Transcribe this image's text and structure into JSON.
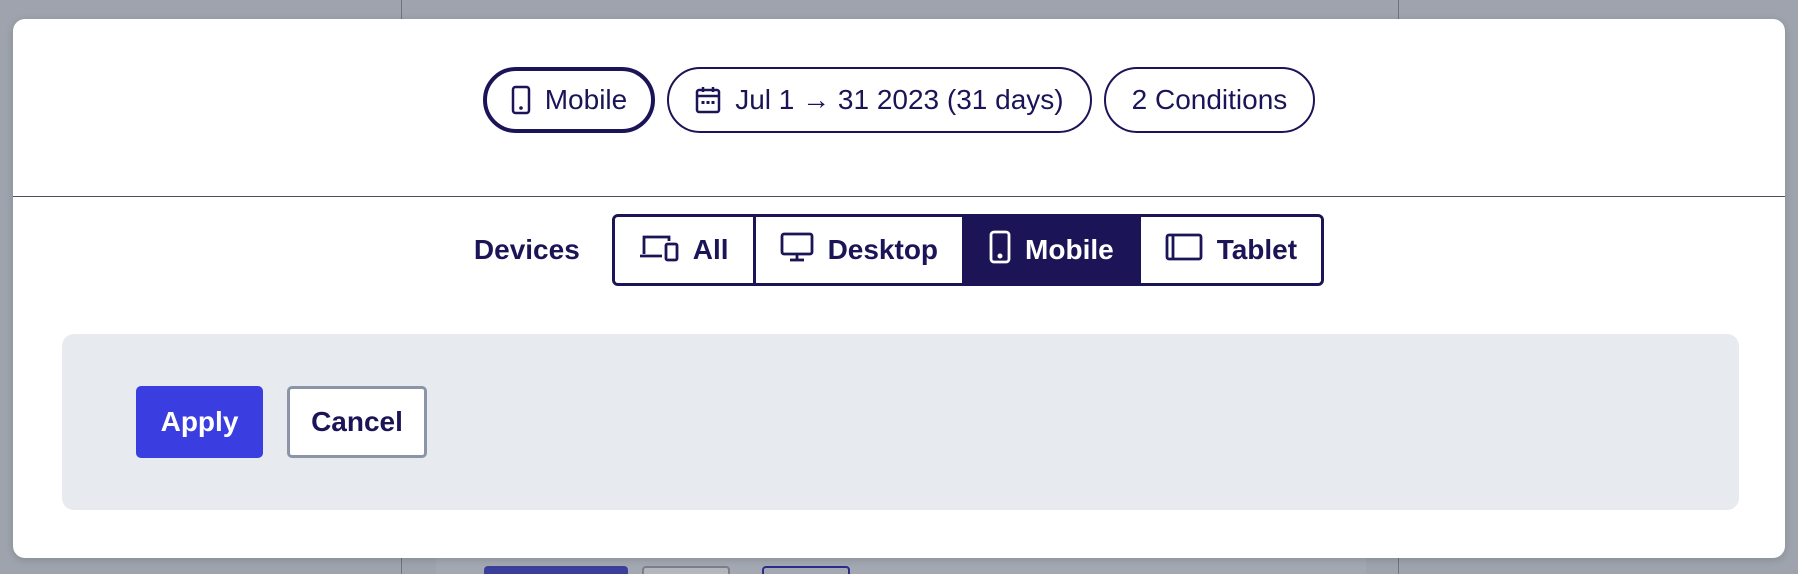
{
  "filters": {
    "device_chip": "Mobile",
    "date_chip": "Jul 1 → 31 2023 (31 days)",
    "conditions_chip": "2 Conditions"
  },
  "devices": {
    "label": "Devices",
    "options": [
      {
        "label": "All",
        "icon": "devices-icon",
        "selected": false
      },
      {
        "label": "Desktop",
        "icon": "desktop-icon",
        "selected": false
      },
      {
        "label": "Mobile",
        "icon": "mobile-icon",
        "selected": true
      },
      {
        "label": "Tablet",
        "icon": "tablet-icon",
        "selected": false
      }
    ]
  },
  "actions": {
    "apply": "Apply",
    "cancel": "Cancel"
  },
  "colors": {
    "text": "#1b1457",
    "selected_bg": "#1b1457",
    "primary": "#3a3de0",
    "footer_bg": "#e7eaef",
    "overlay": "#9ea3ad"
  }
}
